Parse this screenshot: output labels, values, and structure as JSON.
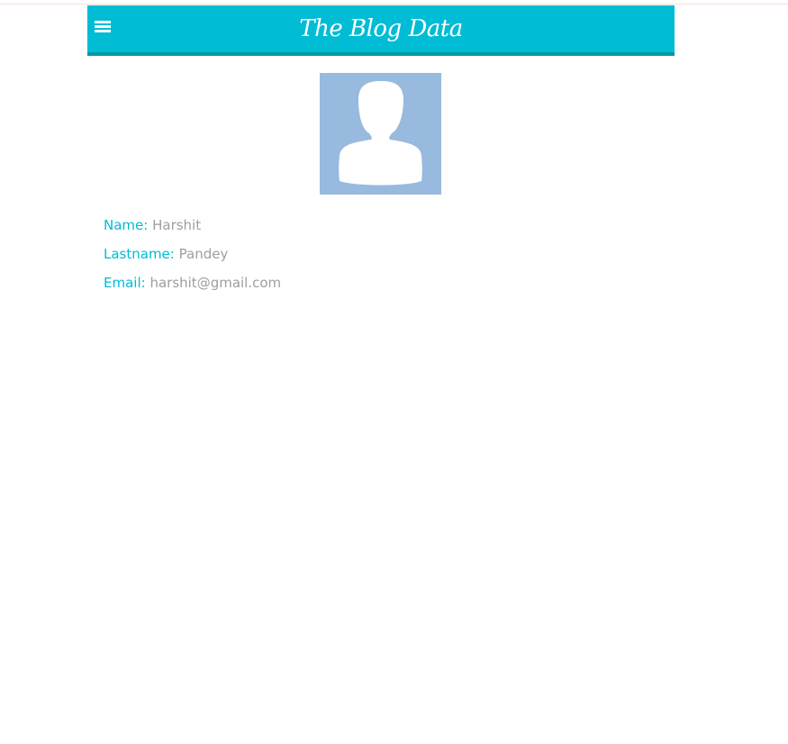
{
  "header": {
    "title": "The Blog Data",
    "menu_icon": "hamburger-menu-icon",
    "background_color": "#00bcd4",
    "border_color": "#0097a7"
  },
  "profile": {
    "avatar_icon": "user-placeholder-icon",
    "avatar_background": "#97bade",
    "fields": {
      "name": {
        "label": "Name:",
        "value": "Harshit"
      },
      "lastname": {
        "label": "Lastname:",
        "value": "Pandey"
      },
      "email": {
        "label": "Email:",
        "value": "harshit@gmail.com"
      }
    },
    "label_color": "#00bcd4",
    "value_color": "#9e9e9e"
  }
}
